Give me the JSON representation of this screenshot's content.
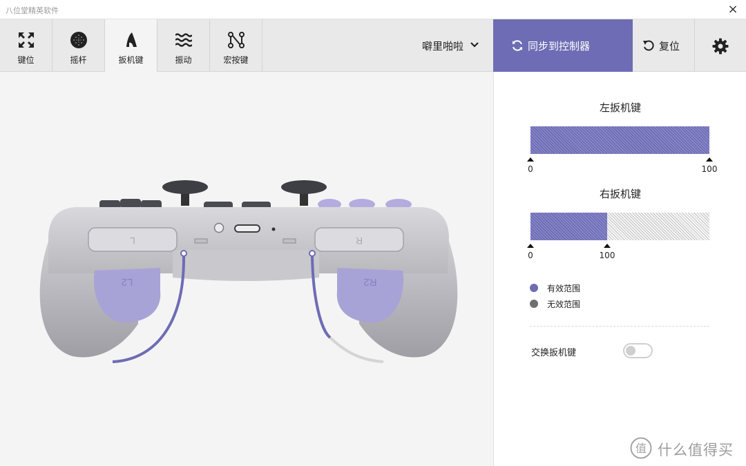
{
  "window": {
    "title": "八位堂精英软件",
    "close_glyph": "×"
  },
  "tabs": [
    {
      "label": "键位",
      "icon": "arrows-expand-icon"
    },
    {
      "label": "摇杆",
      "icon": "joystick-icon"
    },
    {
      "label": "扳机键",
      "icon": "trigger-icon",
      "active": true
    },
    {
      "label": "振动",
      "icon": "waves-icon"
    },
    {
      "label": "宏按键",
      "icon": "macro-nodes-icon"
    }
  ],
  "profile": {
    "name": "噼里啪啦",
    "icon": "chevron-down-icon"
  },
  "actions": {
    "sync_label": "同步到控制器",
    "sync_icon": "sync-icon",
    "reset_label": "复位",
    "reset_icon": "undo-icon",
    "settings_icon": "gear-icon"
  },
  "triggers": {
    "left": {
      "title": "左扳机键",
      "min": 0,
      "max": 100,
      "valid_fraction": 1.0,
      "min_label": "0",
      "max_label": "100"
    },
    "right": {
      "title": "右扳机键",
      "min": 0,
      "max": 100,
      "valid_fraction": 0.43,
      "min_label": "0",
      "max_label": "100"
    }
  },
  "legend": [
    {
      "label": "有效范围",
      "color": "#6d6cb4"
    },
    {
      "label": "无效范围",
      "color": "#6f6f6f"
    }
  ],
  "swap": {
    "label": "交换扳机键",
    "on": false
  },
  "controller": {
    "left_button_label": "L",
    "right_button_label": "R",
    "left_trigger_label": "L2",
    "right_trigger_label": "R2"
  },
  "watermark": {
    "text": "什么值得买",
    "logo_glyph": "值"
  },
  "colors": {
    "accent": "#6d6cb4",
    "trigger_purple": "#a7a3d6"
  }
}
